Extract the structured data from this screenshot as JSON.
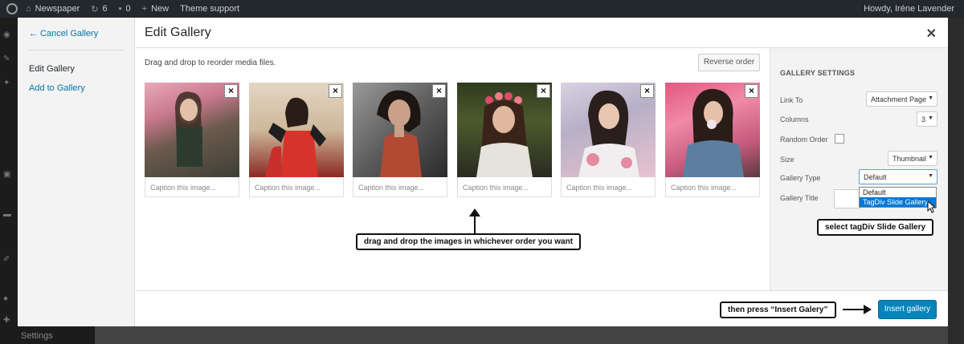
{
  "adminbar": {
    "site_name": "Newspaper",
    "updates_count": "6",
    "comments_count": "0",
    "new_label": "New",
    "theme_support": "Theme support",
    "howdy": "Howdy, Iréne Lavender"
  },
  "wp_menu_bottom": "Settings",
  "sidebar": {
    "cancel": "← Cancel Gallery",
    "edit": "Edit Gallery",
    "add": "Add to Gallery"
  },
  "modal": {
    "title": "Edit Gallery",
    "hint": "Drag and drop to reorder media files.",
    "reverse_order": "Reverse order"
  },
  "images": [
    {
      "caption_placeholder": "Caption this image...",
      "remove": "×"
    },
    {
      "caption_placeholder": "Caption this image...",
      "remove": "×"
    },
    {
      "caption_placeholder": "Caption this image...",
      "remove": "×"
    },
    {
      "caption_placeholder": "Caption this image...",
      "remove": "×"
    },
    {
      "caption_placeholder": "Caption this image...",
      "remove": "×"
    },
    {
      "caption_placeholder": "Caption this image...",
      "remove": "×"
    }
  ],
  "settings": {
    "heading": "GALLERY SETTINGS",
    "link_to_label": "Link To",
    "link_to_value": "Attachment Page",
    "columns_label": "Columns",
    "columns_value": "3",
    "random_order_label": "Random Order",
    "size_label": "Size",
    "size_value": "Thumbnail",
    "gallery_type_label": "Gallery Type",
    "gallery_type_value": "Default",
    "gallery_type_options": [
      "Default",
      "TagDiv Slide Gallery"
    ],
    "gallery_title_label": "Gallery Title"
  },
  "footer": {
    "insert_button": "Insert gallery"
  },
  "callouts": {
    "drag": "drag and drop the images in whichever order you want",
    "select": "select tagDiv Slide Gallery",
    "press": "then press “Insert Galery”"
  }
}
